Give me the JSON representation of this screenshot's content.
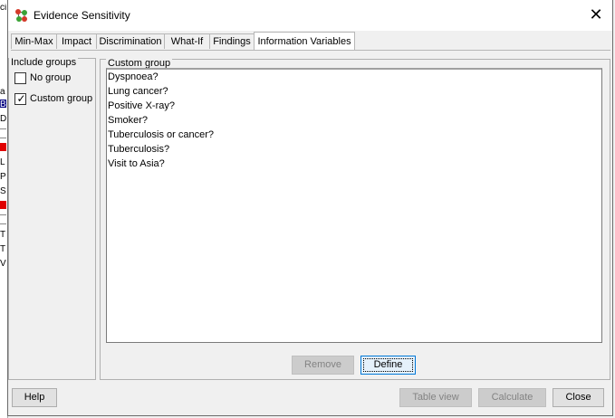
{
  "window": {
    "title": "Evidence Sensitivity",
    "icon": "network-nodes-icon"
  },
  "tabs": [
    {
      "label": "Min-Max",
      "active": false
    },
    {
      "label": "Impact",
      "active": false
    },
    {
      "label": "Discrimination",
      "active": false
    },
    {
      "label": "What-If",
      "active": false
    },
    {
      "label": "Findings",
      "active": false
    },
    {
      "label": "Information Variables",
      "active": true
    }
  ],
  "include_groups": {
    "title": "Include groups",
    "options": [
      {
        "label": "No group",
        "checked": false
      },
      {
        "label": "Custom group",
        "checked": true
      }
    ]
  },
  "custom_group": {
    "title": "Custom group",
    "items": [
      "Dyspnoea?",
      "Lung cancer?",
      "Positive X-ray?",
      "Smoker?",
      "Tuberculosis or cancer?",
      "Tuberculosis?",
      "Visit to Asia?"
    ],
    "remove_label": "Remove",
    "define_label": "Define"
  },
  "footer": {
    "help_label": "Help",
    "table_view_label": "Table view",
    "calculate_label": "Calculate",
    "close_label": "Close"
  },
  "background": {
    "chars": [
      "a",
      "B",
      "D",
      "L",
      "P",
      "S",
      "T",
      "T",
      "V"
    ]
  },
  "colors": {
    "accent_focus": "#0078d7",
    "background_red": "#e00000",
    "background_selected": "#000080"
  }
}
